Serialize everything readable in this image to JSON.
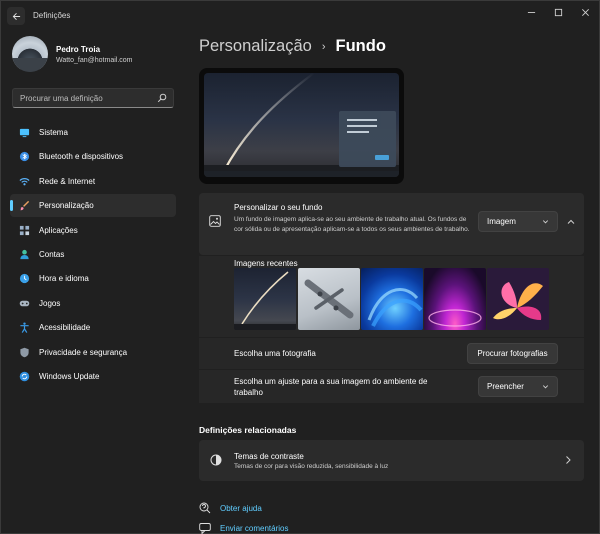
{
  "window": {
    "app_title": "Definições"
  },
  "profile": {
    "name": "Pedro Troia",
    "email": "Watto_fan@hotmail.com"
  },
  "search": {
    "placeholder": "Procurar uma definição"
  },
  "sidebar": {
    "items": [
      {
        "label": "Sistema",
        "icon": "monitor-icon",
        "color": "#4cc2ff"
      },
      {
        "label": "Bluetooth e dispositivos",
        "icon": "bluetooth-icon",
        "color": "#3a8ee6"
      },
      {
        "label": "Rede & Internet",
        "icon": "wifi-icon",
        "color": "#5ab0f5"
      },
      {
        "label": "Personalização",
        "icon": "brush-icon",
        "color": "#e8a060",
        "active": true
      },
      {
        "label": "Aplicações",
        "icon": "apps-icon",
        "color": "#9ab0c8"
      },
      {
        "label": "Contas",
        "icon": "person-icon",
        "color": "#43c2a0"
      },
      {
        "label": "Hora e idioma",
        "icon": "globe-clock-icon",
        "color": "#3aa0e8"
      },
      {
        "label": "Jogos",
        "icon": "gamepad-icon",
        "color": "#a8b4c0"
      },
      {
        "label": "Acessibilidade",
        "icon": "accessibility-icon",
        "color": "#3a9be8"
      },
      {
        "label": "Privacidade e segurança",
        "icon": "shield-icon",
        "color": "#8f9aa6"
      },
      {
        "label": "Windows Update",
        "icon": "update-icon",
        "color": "#2f8fe0"
      }
    ]
  },
  "breadcrumb": {
    "parent": "Personalização",
    "separator": "›",
    "current": "Fundo"
  },
  "background": {
    "title": "Personalizar o seu fundo",
    "description": "Um fundo de imagem aplica-se ao seu ambiente de trabalho atual. Os fundos de cor sólida ou de apresentação aplicam-se a todos os seus ambientes de trabalho.",
    "type_value": "Imagem",
    "recent_title": "Imagens recentes",
    "recent_images": [
      "rocket-launch",
      "aircraft",
      "blue-bloom",
      "purple-glow",
      "colorful-flower"
    ],
    "choose_photo_label": "Escolha uma fotografia",
    "browse_button": "Procurar fotografias",
    "fit_label": "Escolha um ajuste para a sua imagem do ambiente de trabalho",
    "fit_value": "Preencher"
  },
  "related": {
    "title": "Definições relacionadas",
    "contrast_title": "Temas de contraste",
    "contrast_desc": "Temas de cor para visão reduzida, sensibilidade à luz"
  },
  "links": {
    "help": "Obter ajuda",
    "feedback": "Enviar comentários"
  },
  "colors": {
    "accent": "#60cdff",
    "background": "#202020",
    "card": "#2b2b2b"
  }
}
